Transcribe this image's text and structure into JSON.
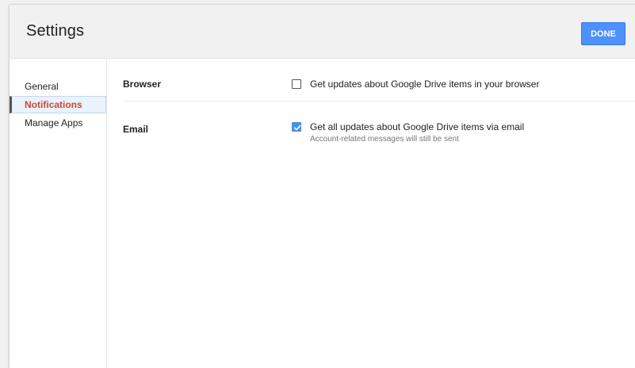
{
  "dialog": {
    "title": "Settings",
    "done_label": "DONE"
  },
  "sidebar": {
    "items": [
      {
        "label": "General",
        "active": false
      },
      {
        "label": "Notifications",
        "active": true
      },
      {
        "label": "Manage Apps",
        "active": false
      }
    ]
  },
  "sections": {
    "browser": {
      "label": "Browser",
      "option_text": "Get updates about Google Drive items in your browser",
      "checked": false
    },
    "email": {
      "label": "Email",
      "option_text": "Get all updates about Google Drive items via email",
      "subtext": "Account-related messages will still be sent",
      "checked": true
    }
  },
  "colors": {
    "accent": "#4d90fe",
    "active_nav_text": "#d14836",
    "checkbox_checked": "#4a90e2"
  },
  "icons": {
    "checkmark": "check-icon"
  }
}
